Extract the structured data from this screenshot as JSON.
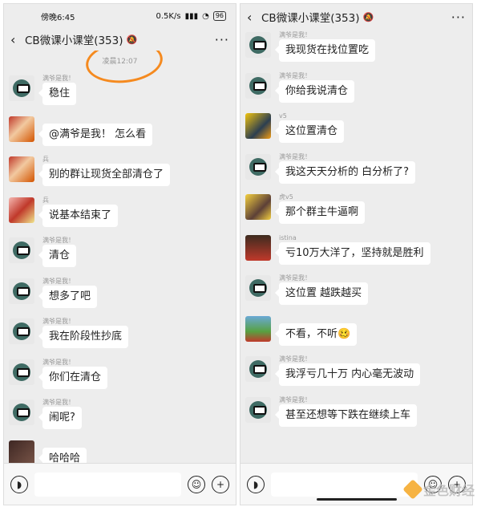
{
  "left": {
    "status": {
      "time": "傍晚6:45",
      "speed": "0.5K/s",
      "battery": "96"
    },
    "title": "CB微课小课堂(353)",
    "timestamp": "凌晨12:07",
    "messages": [
      {
        "nick": "满爷是我！",
        "text": "稳住",
        "avatar": "cartoon"
      },
      {
        "nick": "",
        "text": "@满爷是我！ 怎么看",
        "avatar": "blur1"
      },
      {
        "nick": "兵",
        "text": "别的群让现货全部清仓了",
        "avatar": "blur1"
      },
      {
        "nick": "兵",
        "text": "说基本结束了",
        "avatar": "blur2"
      },
      {
        "nick": "满爷是我！",
        "text": "清仓",
        "avatar": "cartoon"
      },
      {
        "nick": "满爷是我！",
        "text": "想多了吧",
        "avatar": "cartoon"
      },
      {
        "nick": "满爷是我！",
        "text": "我在阶段性抄底",
        "avatar": "cartoon"
      },
      {
        "nick": "满爷是我！",
        "text": "你们在清仓",
        "avatar": "cartoon"
      },
      {
        "nick": "满爷是我！",
        "text": "闹呢?",
        "avatar": "cartoon"
      },
      {
        "nick": "",
        "text": "哈哈哈",
        "avatar": "brown"
      }
    ]
  },
  "right": {
    "title": "CB微课小课堂(353)",
    "messages": [
      {
        "nick": "满爷是我！",
        "text": "我现货在找位置吃",
        "avatar": "cartoon"
      },
      {
        "nick": "满爷是我！",
        "text": "你给我说清仓",
        "avatar": "cartoon"
      },
      {
        "nick": "v5",
        "text": "这位置清仓",
        "avatar": "yellow"
      },
      {
        "nick": "满爷是我！",
        "text": "我这天天分析的  白分析了?",
        "avatar": "cartoon"
      },
      {
        "nick": "虎v5",
        "text": "那个群主牛逼啊",
        "avatar": "gold"
      },
      {
        "nick": "istina",
        "text": "亏10万大洋了，坚持就是胜利",
        "avatar": "dark"
      },
      {
        "nick": "满爷是我！",
        "text": "这位置 越跌越买",
        "avatar": "cartoon"
      },
      {
        "nick": "",
        "text": "不看，不听🥴",
        "avatar": "green"
      },
      {
        "nick": "满爷是我！",
        "text": "我浮亏几十万 内心毫无波动",
        "avatar": "cartoon"
      },
      {
        "nick": "满爷是我！",
        "text": "甚至还想等下跌在继续上车",
        "avatar": "cartoon"
      }
    ]
  },
  "icons": {
    "back": "back-arrow-icon",
    "bell": "mute-bell-icon",
    "more": "more-icon",
    "voice": "voice-icon",
    "emoji": "emoji-icon",
    "plus": "plus-icon"
  },
  "watermark": "金色财经",
  "colors": {
    "annotation": "#f58a1f",
    "chat_bg": "#ededed"
  }
}
